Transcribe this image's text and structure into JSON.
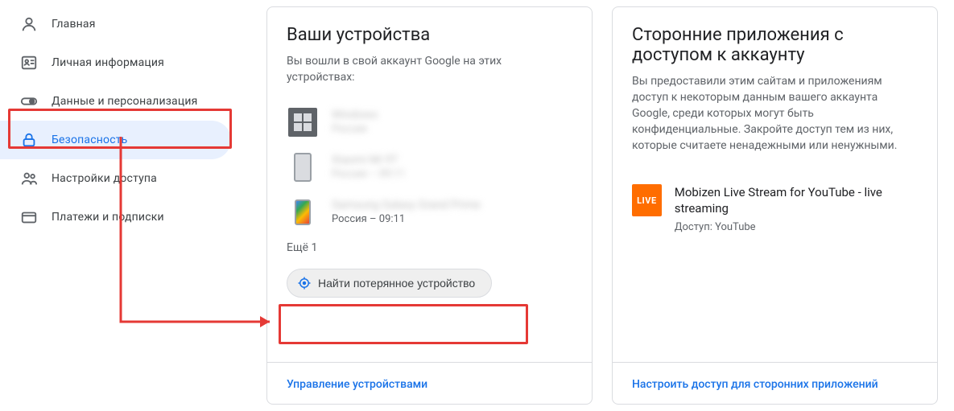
{
  "sidebar": {
    "items": [
      {
        "label": "Главная"
      },
      {
        "label": "Личная информация"
      },
      {
        "label": "Данные и персонализация"
      },
      {
        "label": "Безопасность"
      },
      {
        "label": "Настройки доступа"
      },
      {
        "label": "Платежи и подписки"
      }
    ]
  },
  "devices_card": {
    "title": "Ваши устройства",
    "desc": "Вы вошли в свой аккаунт Google на этих устройствах:",
    "devices": [
      {
        "name": "Windows",
        "meta": "Россия",
        "blurred": true,
        "type": "windows"
      },
      {
        "name": "Xiaomi Mi 9T",
        "meta": "Россия – 09:11",
        "blurred": true,
        "type": "phone"
      },
      {
        "name": "Samsung Galaxy Grand Prime",
        "meta": "Россия – 09:11",
        "blurred_name": true,
        "type": "phone-sm"
      }
    ],
    "more": "Ещё 1",
    "find_device": "Найти потерянное устройство",
    "manage": "Управление устройствами"
  },
  "apps_card": {
    "title": "Сторонние приложения с доступом к аккаунту",
    "desc": "Вы предоставили этим сайтам и приложениям доступ к некоторым данным вашего аккаунта Google, среди которых могут быть конфиденциальные. Закройте доступ тем из них, которые считаете ненадежными или ненужными.",
    "app": {
      "icon_text": "LIVE",
      "name": "Mobizen Live Stream for YouTube - live streaming",
      "access": "Доступ: YouTube"
    },
    "manage": "Настроить доступ для сторонних приложений"
  }
}
